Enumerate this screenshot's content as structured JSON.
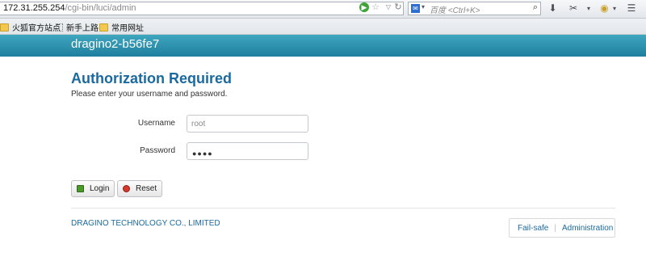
{
  "browser": {
    "url_host": "172.31.255.254",
    "url_path": "/cgi-bin/luci/admin",
    "search_placeholder": "百度 <Ctrl+K>",
    "bookmarks": [
      "火狐官方站点",
      "新手上路",
      "常用网址"
    ]
  },
  "header": {
    "hostname": "dragino2-b56fe7"
  },
  "main": {
    "title": "Authorization Required",
    "description": "Please enter your username and password.",
    "username_label": "Username",
    "username_value": "root",
    "password_label": "Password",
    "password_mask": "●●●●",
    "login_label": "Login",
    "reset_label": "Reset"
  },
  "footer": {
    "company": "DRAGINO TECHNOLOGY CO., LIMITED",
    "failsafe": "Fail-safe",
    "separator": "|",
    "administration": "Administration"
  },
  "colors": {
    "header": "#1f7f9e",
    "title": "#1a6aa0",
    "link": "#1a6aa0"
  }
}
